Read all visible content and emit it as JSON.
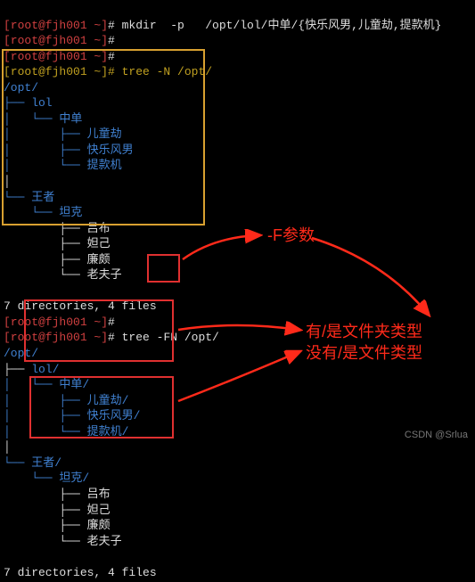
{
  "lines": {
    "l0_red": "[root@fjh001 ~]",
    "l0_cmd": "# mkdir  -p   /opt/lol/中单/{快乐风男,儿童劫,提款机}",
    "l1_red": "[root@fjh001 ~]",
    "l1_cmd": "#",
    "l2_red": "[root@fjh001 ~]",
    "l2_cmd": "#",
    "l3_yellow": "[root@fjh001 ~]# tree -N /opt/",
    "l4": "/opt/",
    "l5": "├── lol",
    "l6": "│   └── 中单",
    "l7": "│       ├── 儿童劫",
    "l8": "│       ├── 快乐风男",
    "l9": "│       └── 提款机",
    "l10": "│",
    "l11": "└── 王者",
    "l12": "    └── 坦克",
    "l13": "        ├── 吕布",
    "l14": "        ├── 妲己",
    "l15": "        ├── 廉颇",
    "l16": "        └── 老夫子",
    "stat1": "7 directories, 4 files",
    "l17_red": "[root@fjh001 ~]",
    "l17_cmd": "#",
    "l18_red": "[root@fjh001 ~]",
    "l18a": "# tree ",
    "l18b": "-FN",
    "l18c": " /opt/",
    "l19": "/opt/",
    "l20_a": "├── ",
    "l20_b": "lol/",
    "l21": "│   └── 中单/",
    "l22": "│       ├── 儿童劫/",
    "l23": "│       ├── 快乐风男/",
    "l24": "│       └── 提款机/",
    "l25": "│",
    "l26": "└── 王者/",
    "l27": "    └── 坦克/",
    "l28": "        ├── 吕布",
    "l29": "        ├── 妲己",
    "l30": "        ├── 廉颇",
    "l31": "        └── 老夫子",
    "stat2": "7 directories, 4 files"
  },
  "annotations": {
    "param": "-F参数",
    "isdir": "有/是文件夹类型",
    "isfile": "没有/是文件类型"
  },
  "watermark": "CSDN @Srlua"
}
